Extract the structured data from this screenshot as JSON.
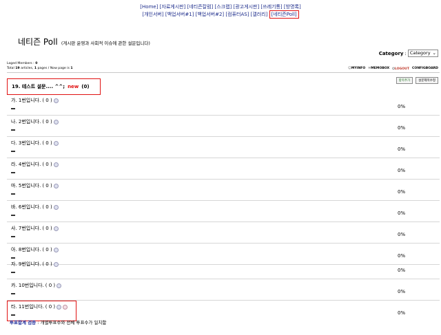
{
  "topnav": {
    "row1": [
      "[Home]",
      "[자료게시판]",
      "[네티즌칼럼]",
      "[스크랩]",
      "[광고게시판]",
      "[쓰레기통]",
      "[방명록]"
    ],
    "row2": [
      "[개인서버]",
      "[백업서버#1]",
      "[백업서버#2]",
      "[컴퓨터AS]",
      "[갤러리]"
    ],
    "highlighted": "[네티즌Poll]"
  },
  "page": {
    "title": "네티즌 Poll",
    "subtitle": "(게시판 운영과 사회적 이슈에 관한 설문입니다)"
  },
  "category": {
    "label": "Category",
    "separator": ":",
    "selected": "Category"
  },
  "meta": {
    "loged_members_label": "Loged Members :",
    "loged_members_value": "0",
    "total_prefix": "Total",
    "total_articles": "19",
    "articles_word": "articles,",
    "pages": "1",
    "pages_text": "pages / Now page is",
    "now_page": "1"
  },
  "toolbar": {
    "myinfo": "MYINFO",
    "memobox": "MEMOBOX",
    "logout": "LOGOUT",
    "config": "CONFIG",
    "board": "BOARD"
  },
  "poll": {
    "question": "19. 테스트 설문.... ^^;",
    "new_badge": "new",
    "count": "(0)",
    "button_edit": "항목추가",
    "button_manage": "설문제목수정",
    "options": [
      {
        "label": "가. 1번입니다.",
        "votes": "( 0 )",
        "percent": "0%"
      },
      {
        "label": "나. 2번입니다.",
        "votes": "( 0 )",
        "percent": "0%"
      },
      {
        "label": "다. 3번입니다.",
        "votes": "( 0 )",
        "percent": "0%"
      },
      {
        "label": "라. 4번입니다.",
        "votes": "( 0 )",
        "percent": "0%"
      },
      {
        "label": "마. 5번입니다.",
        "votes": "( 0 )",
        "percent": "0%"
      },
      {
        "label": "바. 6번입니다.",
        "votes": "( 0 )",
        "percent": "0%"
      },
      {
        "label": "사. 7번입니다.",
        "votes": "( 0 )",
        "percent": "0%"
      },
      {
        "label": "아. 8번입니다.",
        "votes": "( 0 )",
        "percent": "0%"
      },
      {
        "label": "자. 9번입니다.",
        "votes": "( 0 )",
        "percent": "0%"
      },
      {
        "label": "카. 10번입니다.",
        "votes": "( 0 )",
        "percent": "0%"
      },
      {
        "label": "타. 11번입니다.",
        "votes": "( 0 )",
        "percent": "0%"
      }
    ]
  },
  "footer": {
    "check_label": "투표합계 검증",
    "check_text": ": 개별투표수와 전체 투표수가 일치함"
  },
  "icons": {
    "vote": "vote-icon",
    "delete": "delete-icon",
    "dropdown": "chevron-down-icon"
  },
  "colors": {
    "highlight": "#e01010",
    "link": "#1a2a8a",
    "new": "#e01010"
  }
}
